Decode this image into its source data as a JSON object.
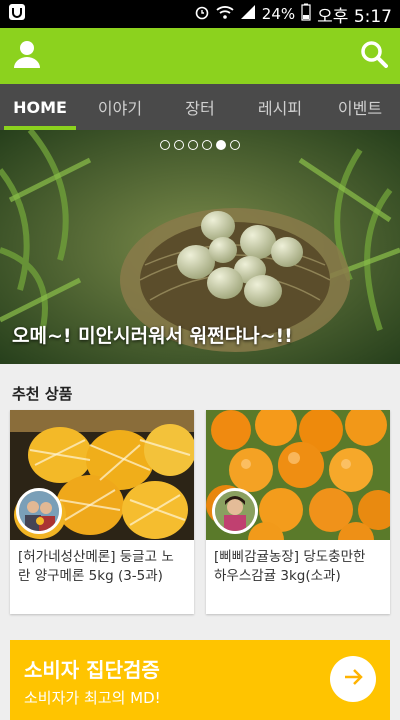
{
  "status_bar": {
    "battery": "24%",
    "time": "오후 5:17",
    "icons": [
      "app-notification-icon",
      "alarm-icon",
      "wifi-icon",
      "signal-icon",
      "battery-icon"
    ]
  },
  "appbar": {
    "profile_icon": "person-icon",
    "search_icon": "search-icon",
    "color": "#8cd21e"
  },
  "tabs": [
    {
      "label": "HOME",
      "active": true
    },
    {
      "label": "이야기",
      "active": false
    },
    {
      "label": "장터",
      "active": false
    },
    {
      "label": "레시피",
      "active": false
    },
    {
      "label": "이벤트",
      "active": false
    }
  ],
  "hero": {
    "caption": "오메~!  미안시러워서 워쩐댜나~!!",
    "slides": 6,
    "active_slide": 5
  },
  "recommended": {
    "title": "추천 상품",
    "items": [
      {
        "title": "[허가네성산메론] 둥글고 노란 양구메론 5kg (3-5과)"
      },
      {
        "title": "[삐삐감귤농장] 당도충만한 하우스감귤 3kg(소과)"
      }
    ]
  },
  "banner": {
    "title": "소비자 집단검증",
    "subtitle": "소비자가 최고의 MD!",
    "arrow_icon": "arrow-right-icon",
    "color": "#ffc400"
  }
}
